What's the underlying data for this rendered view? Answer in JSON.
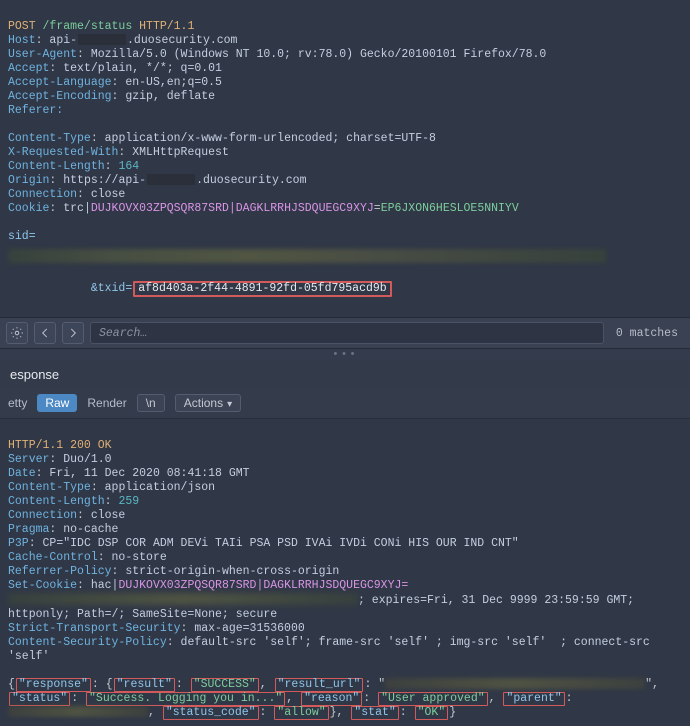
{
  "request": {
    "method": "POST",
    "path": "/frame/status",
    "proto": "HTTP/1.1",
    "headers": {
      "host_prefix": "api-",
      "host_suffix": ".duosecurity.com",
      "user_agent": "Mozilla/5.0 (Windows NT 10.0; rv:78.0) Gecko/20100101 Firefox/78.0",
      "accept": "text/plain, */*; q=0.01",
      "accept_language": "en-US,en;q=0.5",
      "accept_encoding": "gzip, deflate",
      "referer_label": "Referer:",
      "content_type": "application/x-www-form-urlencoded; charset=UTF-8",
      "x_requested_with": "XMLHttpRequest",
      "content_length": "164",
      "origin_prefix": "https://api-",
      "origin_suffix": ".duosecurity.com",
      "connection": "close",
      "cookie_prefix": "trc|",
      "cookie_mid": "DUJKOVX03ZPQSQR87SRD|DAGKLRRHJSDQUEGC9XYJ",
      "cookie_suffix": "EP6JXON6HESLOE5NNIYV"
    },
    "body": {
      "sid_label": "sid=",
      "txid_label": "&txid=",
      "txid_value": "af8d403a-2f44-4891-92fd-05fd795acd9b"
    }
  },
  "toolbar": {
    "search_placeholder": "Search…",
    "matches_text": "0 matches"
  },
  "response_header": "esponse",
  "tabs": {
    "pretty": "etty",
    "raw": "Raw",
    "render": "Render",
    "newline": "\\n",
    "actions": "Actions"
  },
  "response": {
    "status_line": "HTTP/1.1 200 OK",
    "server": "Duo/1.0",
    "date": "Fri, 11 Dec 2020 08:41:18 GMT",
    "content_type": "application/json",
    "content_length": "259",
    "connection": "close",
    "pragma": "no-cache",
    "p3p": "CP=\"IDC DSP COR ADM DEVi TAIi PSA PSD IVAi IVDi CONi HIS OUR IND CNT\"",
    "cache_control": "no-store",
    "referrer_policy": "strict-origin-when-cross-origin",
    "set_cookie_prefix": "hac|",
    "set_cookie_mid": "DUJKOVX03ZPQSQR87SRD|DAGKLRRHJSDQUEGC9XYJ=",
    "set_cookie_tail": "; expires=Fri, 31 Dec 9999 23:59:59 GMT; httponly; Path=/; SameSite=None; secure",
    "sts": "max-age=31536000",
    "csp": "default-src 'self'; frame-src 'self' ; img-src 'self'  ; connect-src 'self'",
    "body": {
      "l1a": "{",
      "l1b": "\"response\"",
      "l1c": ": {",
      "l1d": "\"result\"",
      "l1e": ": ",
      "l1f": "\"SUCCESS\"",
      "l1g": ", ",
      "l1h": "\"result_url\"",
      "l1i": ": \"",
      "l2a": "\"status\"",
      "l2b": ": ",
      "l2c": "\"Success. Logging you in...\"",
      "l2d": ", ",
      "l2e": "\"reason\"",
      "l2f": ": ",
      "l2g": "\"User approved\"",
      "l2h": ", ",
      "l2i": "\"parent\"",
      "l2j": ":",
      "l3a": ", ",
      "l3b": "\"status_code\"",
      "l3c": ": ",
      "l3d": "\"allow\"",
      "l3e": "}, ",
      "l3f": "\"stat\"",
      "l3g": ": ",
      "l3h": "\"OK\"",
      "l3i": "}"
    }
  }
}
